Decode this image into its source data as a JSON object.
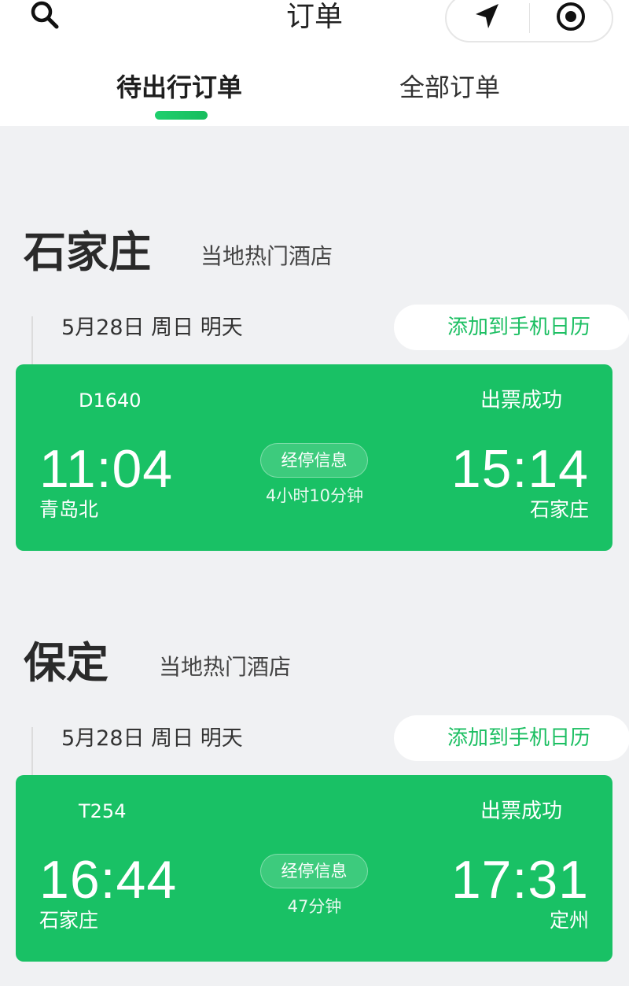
{
  "header": {
    "title": "订单",
    "search_icon": "search-icon",
    "location_icon": "navigation-arrow-icon",
    "target_icon": "target-circle-icon"
  },
  "tabs": [
    {
      "label": "待出行订单",
      "active": true
    },
    {
      "label": "全部订单",
      "active": false
    }
  ],
  "colors": {
    "accent": "#19c165",
    "background": "#f0f1f3",
    "calendar_text": "#1dbf63"
  },
  "trips": [
    {
      "city": "石家庄",
      "hotel_link": "当地热门酒店",
      "date": "5月28日 周日 明天",
      "calendar_button": "添加到手机日历",
      "train_no": "D1640",
      "status": "出票成功",
      "dep_time": "11:04",
      "dep_station": "青岛北",
      "stops_button": "经停信息",
      "duration": "4小时10分钟",
      "arr_time": "15:14",
      "arr_station": "石家庄"
    },
    {
      "city": "保定",
      "hotel_link": "当地热门酒店",
      "date": "5月28日 周日 明天",
      "calendar_button": "添加到手机日历",
      "train_no": "T254",
      "status": "出票成功",
      "dep_time": "16:44",
      "dep_station": "石家庄",
      "stops_button": "经停信息",
      "duration": "47分钟",
      "arr_time": "17:31",
      "arr_station": "定州"
    }
  ]
}
